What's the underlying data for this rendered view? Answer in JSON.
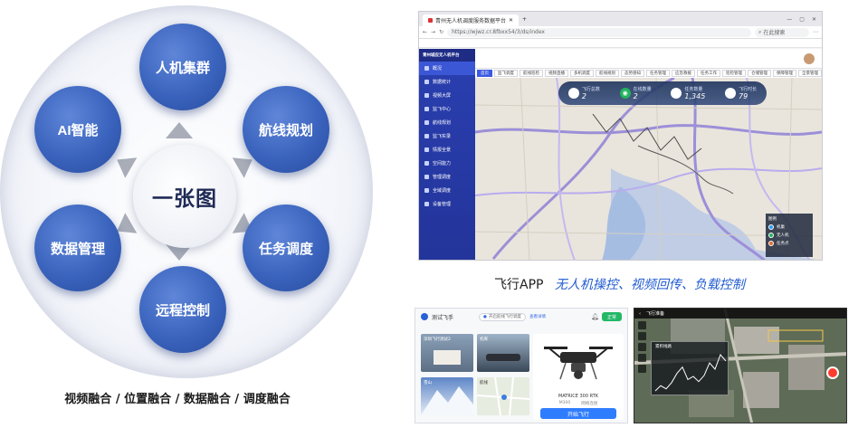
{
  "diagram": {
    "center_label": "一张图",
    "nodes": [
      {
        "id": "cluster",
        "label": "人机集群"
      },
      {
        "id": "route",
        "label": "航线规划"
      },
      {
        "id": "task",
        "label": "任务调度"
      },
      {
        "id": "remote",
        "label": "远程控制"
      },
      {
        "id": "data",
        "label": "数据管理"
      },
      {
        "id": "ai",
        "label": "AI智能"
      }
    ],
    "caption": "视频融合 / 位置融合 / 数据融合 / 调度融合"
  },
  "browser": {
    "tab_title": "青州无人机调度服务数据平台",
    "url": "https://wjwz.cr.8fbxx54/3/ds/index",
    "search_placeholder": "在此搜索"
  },
  "platform": {
    "brand": "青州城应无人机平台",
    "sidebar_items": [
      "概况",
      "数据统计",
      "视频大屏",
      "监飞中心",
      "航线规划",
      "监飞实录",
      "情报全景",
      "空间能力",
      "管理调度",
      "全域调度",
      "设备管理"
    ],
    "tabs": [
      "首页",
      "监飞调度",
      "航线巡检",
      "视频直播",
      "多机调度",
      "航线规划",
      "态势感知",
      "任务管理",
      "应急救援",
      "任务工作",
      "巡检管理",
      "仓储管理",
      "保障管理",
      "全景管理"
    ],
    "stats": [
      {
        "label": "飞行总数",
        "value": "2",
        "icon": "drone-icon"
      },
      {
        "label": "在线数量",
        "value": "2",
        "icon": "signal-icon"
      },
      {
        "label": "任务数量",
        "value": "1,345",
        "icon": "task-icon"
      },
      {
        "label": "飞行时长",
        "value": "79",
        "icon": "clock-icon"
      }
    ],
    "legend_title": "图例",
    "legend_items": [
      "机巢",
      "无人机",
      "任务点"
    ]
  },
  "app_caption": {
    "title": "飞行APP",
    "subtitle": "无人机操控、视频回传、负载控制"
  },
  "flight_app": {
    "name": "测试飞手",
    "pill_text": "开启航线飞行调度",
    "link_text": "查看详情",
    "status": "正常",
    "thumbs": [
      {
        "label": "深圳飞行测试2"
      },
      {
        "label": "机库"
      },
      {
        "label": "雪山"
      },
      {
        "label": "航线"
      }
    ],
    "drone_model": "MATRICE 300 RTK",
    "drone_meta": [
      "M300",
      "网络连接"
    ],
    "fly_button": "开始飞行"
  },
  "flight_control": {
    "status": "飞行准备",
    "chart_title": "累积线路",
    "chart_series": [
      7,
      12,
      9,
      15,
      24,
      30,
      18,
      21,
      16,
      22,
      34,
      28,
      42,
      36
    ]
  }
}
